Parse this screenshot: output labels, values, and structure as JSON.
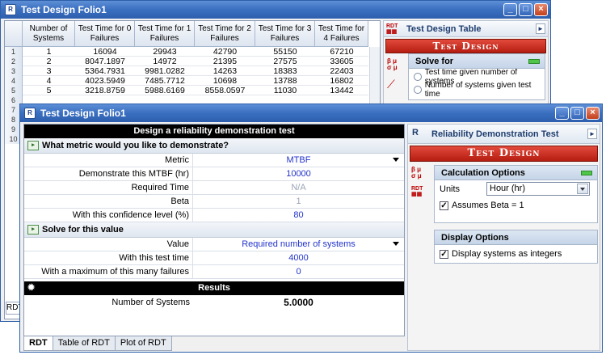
{
  "back_window": {
    "title": "Test Design Folio1",
    "table": {
      "headers": [
        "Number of Systems",
        "Test Time for 0 Failures",
        "Test Time for 1 Failures",
        "Test Time for 2 Failures",
        "Test Time for 3 Failures",
        "Test Time for 4 Failures"
      ],
      "rows": [
        [
          "1",
          "16094",
          "29943",
          "42790",
          "55150",
          "67210"
        ],
        [
          "2",
          "8047.1897",
          "14972",
          "21395",
          "27575",
          "33605"
        ],
        [
          "3",
          "5364.7931",
          "9981.0282",
          "14263",
          "18383",
          "22403"
        ],
        [
          "4",
          "4023.5949",
          "7485.7712",
          "10698",
          "13788",
          "16802"
        ],
        [
          "5",
          "3218.8759",
          "5988.6169",
          "8558.0597",
          "11030",
          "13442"
        ]
      ],
      "row_numbers": [
        "1",
        "2",
        "3",
        "4",
        "5",
        "6",
        "7",
        "8",
        "9",
        "10"
      ]
    },
    "panel": {
      "title": "Test Design Table",
      "banner": "Test Design",
      "solve_for": {
        "header": "Solve for",
        "options": [
          "Test time given number of systems",
          "Number of systems given test time"
        ]
      }
    },
    "bottom_tab": "RDT"
  },
  "front_window": {
    "title": "Test Design Folio1",
    "form": {
      "header": "Design a reliability demonstration test",
      "section1": "What metric would you like to demonstrate?",
      "rows1": [
        {
          "label": "Metric",
          "value": "MTBF"
        },
        {
          "label": "Demonstrate this MTBF (hr)",
          "value": "10000"
        },
        {
          "label": "Required Time",
          "value": "N/A"
        },
        {
          "label": "Beta",
          "value": "1"
        },
        {
          "label": "With this confidence level (%)",
          "value": "80"
        }
      ],
      "section2": "Solve for this value",
      "rows2": [
        {
          "label": "Value",
          "value": "Required number of systems"
        },
        {
          "label": "With this test time",
          "value": "4000"
        },
        {
          "label": "With a maximum of this many failures",
          "value": "0"
        }
      ],
      "results_header": "Results",
      "result": {
        "label": "Number of Systems",
        "value": "5.0000"
      }
    },
    "tabs": [
      "RDT",
      "Table of RDT",
      "Plot of RDT"
    ],
    "panel": {
      "title": "Reliability Demonstration Test",
      "banner": "Test Design",
      "calc": {
        "header": "Calculation Options",
        "units_label": "Units",
        "units_value": "Hour (hr)",
        "assumes_beta": "Assumes Beta = 1"
      },
      "display": {
        "header": "Display Options",
        "integers": "Display systems as integers"
      }
    }
  },
  "colors": {
    "title": "#3a6fc0",
    "banner": "#c52618",
    "value_text": "#2233cc"
  }
}
